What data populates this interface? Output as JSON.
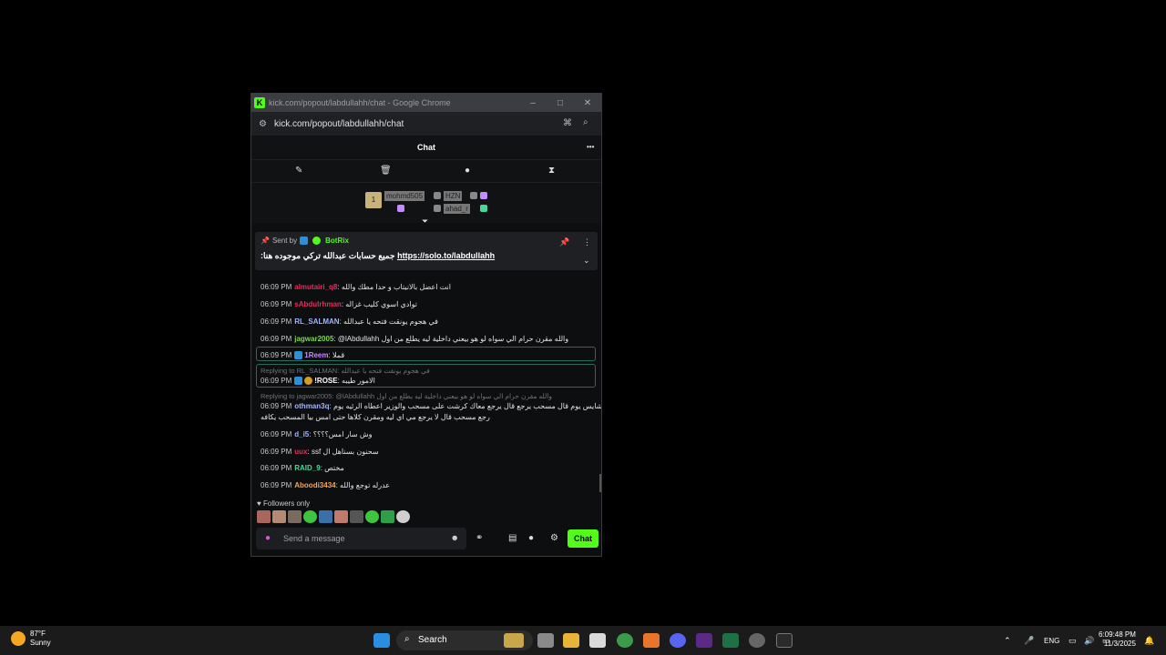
{
  "window": {
    "title": "kick.com/popout/labdullahh/chat - Google Chrome",
    "url": "kick.com/popout/labdullahh/chat",
    "buttons": [
      "–",
      "□",
      "✕"
    ]
  },
  "chat": {
    "header": "Chat",
    "menu_icon": "•••",
    "tools": [
      "pin-icon",
      "trash-icon",
      "chat-bubble-icon",
      "hourglass-icon"
    ],
    "gifters": [
      {
        "label": "mohmd505",
        "rank": "1"
      },
      {
        "label": "HZN"
      },
      {
        "label": "ahad_r"
      }
    ],
    "pinned": {
      "sent_by_label": "Sent by",
      "bot_name": "BotRix",
      "message_prefix": ":جميع حسابات عبدالله تركي موجوده هنا",
      "link": "https://solo.to/labdullahh"
    },
    "messages": [
      {
        "time": "06:09 PM",
        "user": "almutairi_q8",
        "color": "#e22f5c",
        "text": "انت اعضل بالانيتاب و حدا مطك والله"
      },
      {
        "time": "06:09 PM",
        "user": "sAbdulrhman",
        "color": "#e22f5c",
        "text": "توادي اسوي كليب غزاله"
      },
      {
        "time": "06:09 PM",
        "user": "RL_SALMAN",
        "color": "#9fb5ff",
        "text": "في هجوم يونقت فتحه يا عبدالله"
      },
      {
        "time": "06:09 PM",
        "user": "jagwar2005",
        "color": "#7cd94a",
        "text": "@lAbdullahh والله مقرن حرام الي سواه لو هو بيعني داخلية ليه يطلع من اول"
      },
      {
        "time": "06:09 PM",
        "user": "1Reem",
        "color": "#c58cff",
        "text": "قملا",
        "highlight": true
      },
      {
        "reply": "Replying to RL_SALMAN: في هجوم يونقت فتحه يا عبدالله",
        "time": "06:09 PM",
        "user": "!ROSE",
        "color": "#ffffff",
        "text": "الامور طيبه",
        "highlight": true
      },
      {
        "reply": "Replying to jagwar2005: @lAbdullahh والله مقرن حرام الي سواه لو هو بيعني داخلية ليه يطلع من اول",
        "time": "06:09 PM",
        "user": "othman3q",
        "color": "#9fb5ff",
        "text": "هو انسط بموقف شايس يوم قال مسحب يرجع قال يرجع معاك كرشت على مسحب والوزير اعطاه الرئيه يوم",
        "text2": "رجع مسحب قال لا يرجع مي اي ليه ومقرن كلاها حتى امس بيا المسحب يكافه"
      },
      {
        "time": "06:09 PM",
        "user": "d_i5",
        "color": "#9fb5ff",
        "text": "وش سار امس؟؟؟؟"
      },
      {
        "time": "06:09 PM",
        "user": "uux",
        "color": "#e22f5c",
        "text": "ssf سحنون بسناهل ال"
      },
      {
        "time": "06:09 PM",
        "user": "RAID_9",
        "color": "#4bd6a0",
        "text": "مختص"
      },
      {
        "time": "06:09 PM",
        "user": "Aboodi3434",
        "color": "#f5a55a",
        "text": "عدرله توجع والله"
      }
    ],
    "followers_only": "Followers only",
    "input_placeholder": "Send a message",
    "send_label": "Chat"
  },
  "taskbar": {
    "temp": "87°F",
    "condition": "Sunny",
    "search_label": "Search",
    "language": "ENG",
    "time": "6:09:48 PM",
    "date": "11/3/2025"
  }
}
